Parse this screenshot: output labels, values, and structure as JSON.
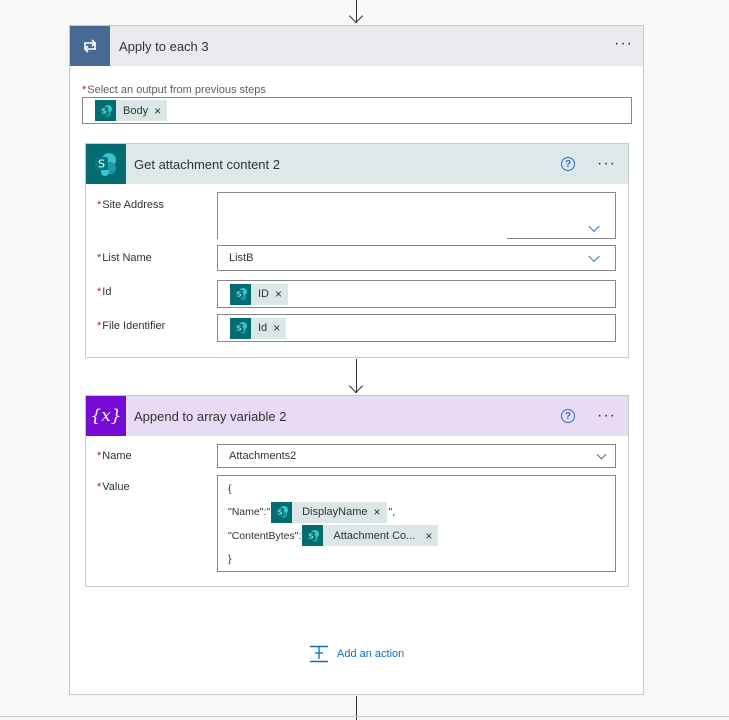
{
  "apply_to_each": {
    "title": "Apply to each 3",
    "menu_icon": "ellipsis-icon",
    "output_label": "Select an output from previous steps",
    "output_token": "Body",
    "header_color": "#486991"
  },
  "get_attachment": {
    "title": "Get attachment content 2",
    "icon": "sharepoint-icon",
    "help_icon": "?",
    "header_color": "#dde9e8",
    "fields": {
      "site_address_label": "Site Address",
      "site_address_value": "",
      "list_name_label": "List Name",
      "list_name_value": "ListB",
      "id_label": "Id",
      "id_token": "ID",
      "file_identifier_label": "File Identifier",
      "file_identifier_token": "Id"
    }
  },
  "append_array": {
    "title": "Append to array variable 2",
    "icon": "variable-icon",
    "icon_text": "{x}",
    "help_icon": "?",
    "header_color": "#e8dcf5",
    "icon_color": "#770bd6",
    "fields": {
      "name_label": "Name",
      "name_value": "Attachments2",
      "value_label": "Value",
      "value_line1": "{",
      "value_line2_prefix": "\"Name\":\"",
      "value_line2_token": "DisplayName",
      "value_line2_suffix": "\",",
      "value_line3_prefix": "\"ContentBytes\":",
      "value_line3_token": "Attachment Co...",
      "value_line4": "}"
    }
  },
  "add_action": {
    "label": "Add an action",
    "icon": "add-action-icon"
  },
  "token_remove": "×",
  "sp_letter": "S"
}
